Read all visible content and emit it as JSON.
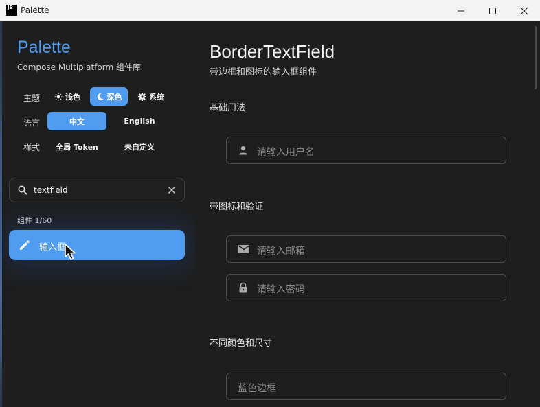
{
  "window": {
    "title": "Palette",
    "app_icon_text": "JB"
  },
  "sidebar": {
    "title": "Palette",
    "subtitle": "Compose Multiplatform 组件库",
    "theme": {
      "label": "主题",
      "options": [
        "浅色",
        "深色",
        "系统"
      ],
      "selected": "深色"
    },
    "language": {
      "label": "语言",
      "options": [
        "中文",
        "English"
      ],
      "selected": "中文"
    },
    "style": {
      "label": "样式",
      "options": [
        "全局 Token",
        "未自定义"
      ]
    },
    "search": {
      "value": "textfield"
    },
    "count": "组件 1/60",
    "items": [
      {
        "label": "输入框",
        "selected": true
      }
    ]
  },
  "main": {
    "title": "BorderTextField",
    "subtitle": "带边框和图标的输入框组件",
    "sections": [
      {
        "title": "基础用法",
        "fields": [
          {
            "placeholder": "请输入用户名",
            "icon": "person-icon"
          }
        ]
      },
      {
        "title": "带图标和验证",
        "fields": [
          {
            "placeholder": "请输入邮箱",
            "icon": "mail-icon"
          },
          {
            "placeholder": "请输入密码",
            "icon": "lock-icon"
          }
        ]
      },
      {
        "title": "不同颜色和尺寸",
        "fields": [
          {
            "placeholder": "蓝色边框",
            "icon": ""
          }
        ]
      }
    ]
  },
  "colors": {
    "accent": "#4f9cf0",
    "background": "#1e1e1e",
    "titlebar": "#f3f3f3"
  }
}
